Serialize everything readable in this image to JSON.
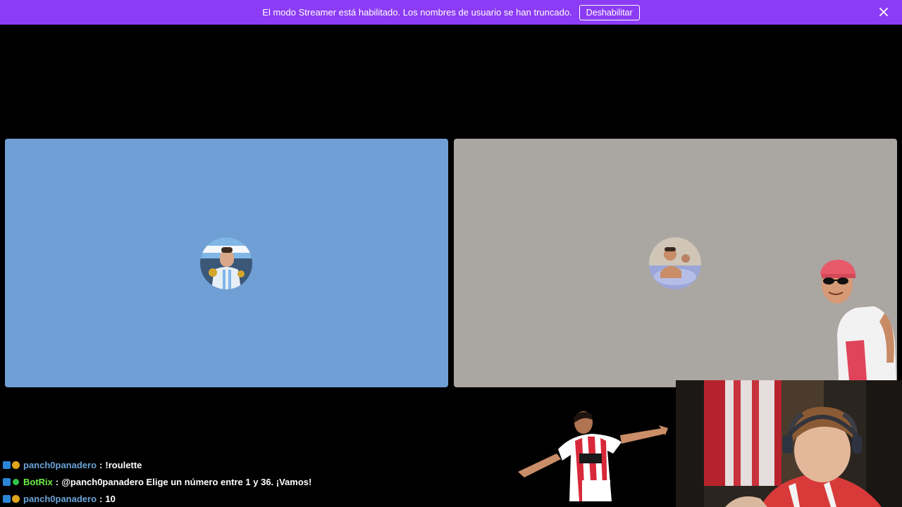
{
  "banner": {
    "message": "El modo Streamer está habilitado. Los nombres de usuario se han truncado.",
    "button_label": "Deshabilitar",
    "background": "#8c3cf4"
  },
  "panels": {
    "left_color": "#709fd6",
    "right_color": "#aaa6a2"
  },
  "chat": {
    "messages": [
      {
        "user": "panch0panadero",
        "separator": ":",
        "text": "!roulette"
      },
      {
        "user": "BotRix",
        "separator": ":",
        "text": "@panch0panadero Elige un número entre 1 y 36. ¡Vamos!"
      },
      {
        "user": "panch0panadero",
        "separator": ":",
        "text": "10"
      }
    ]
  },
  "icons": {
    "close": "close-icon",
    "badges": [
      "moderator-badge-icon",
      "subscriber-badge-icon",
      "verified-badge-icon"
    ]
  }
}
